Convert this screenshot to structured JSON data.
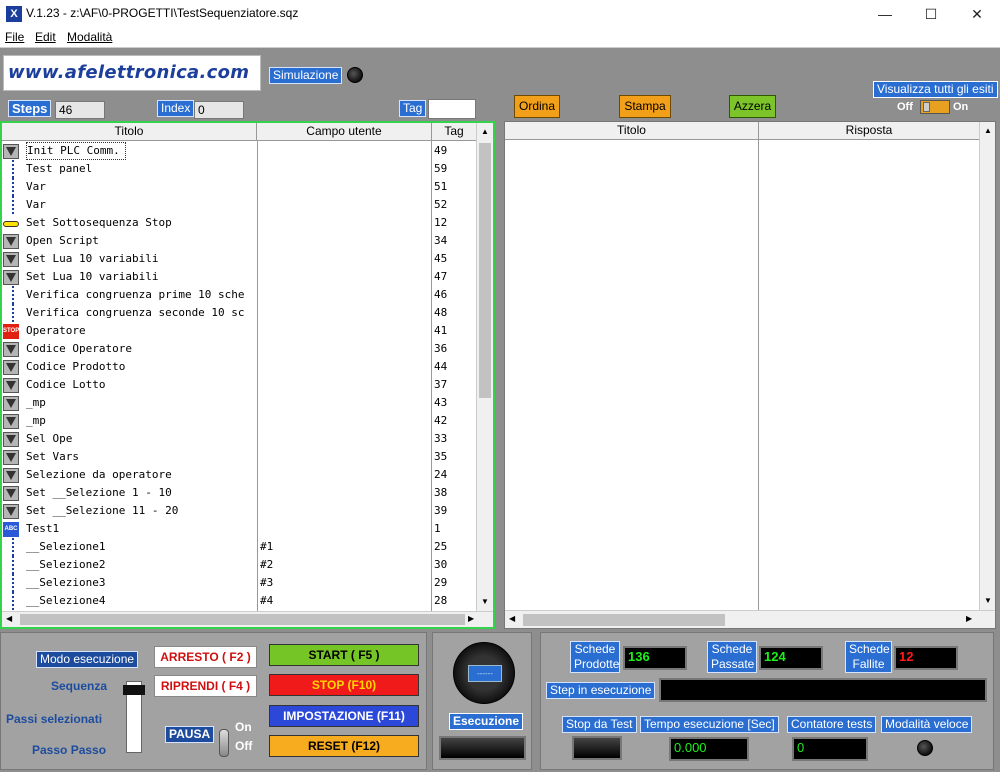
{
  "window": {
    "title": "V.1.23 - z:\\AF\\0-PROGETTI\\TestSequenziatore.sqz",
    "minimize": "—",
    "maximize": "☐",
    "close": "✕"
  },
  "menu": [
    "File",
    "Edit",
    "Modalità"
  ],
  "logo": "www.afelettronica.com",
  "simulazione": "Simulazione",
  "steps": {
    "label": "Steps",
    "value": "46"
  },
  "index": {
    "label": "Index",
    "value": "0"
  },
  "tag": {
    "label": "Tag",
    "value": ""
  },
  "toolbar": {
    "ordina": "Ordina",
    "stampa": "Stampa",
    "azzera": "Azzera"
  },
  "visualizza": {
    "label": "Visualizza tutti gli esiti",
    "off": "Off",
    "on": "On"
  },
  "left_table": {
    "headers": [
      "Titolo",
      "Campo utente",
      "Tag"
    ],
    "rows": [
      {
        "icon": "filter",
        "title": "Init PLC Comm.",
        "campo": "",
        "tag": "49"
      },
      {
        "icon": "line",
        "title": "Test panel",
        "campo": "",
        "tag": "59"
      },
      {
        "icon": "line",
        "title": "Var",
        "campo": "",
        "tag": "51"
      },
      {
        "icon": "line",
        "title": "Var",
        "campo": "",
        "tag": "52"
      },
      {
        "icon": "arrow",
        "title": "Set Sottosequenza Stop",
        "campo": "",
        "tag": "12"
      },
      {
        "icon": "filter",
        "title": "Open Script",
        "campo": "",
        "tag": "34"
      },
      {
        "icon": "filter",
        "title": "Set Lua 10 variabili",
        "campo": "",
        "tag": "45"
      },
      {
        "icon": "filter",
        "title": "Set Lua 10 variabili",
        "campo": "",
        "tag": "47"
      },
      {
        "icon": "line",
        "title": "Verifica congruenza prime 10 sche",
        "campo": "",
        "tag": "46"
      },
      {
        "icon": "line",
        "title": "Verifica congruenza seconde 10 sc",
        "campo": "",
        "tag": "48"
      },
      {
        "icon": "stop",
        "title": "Operatore",
        "campo": "",
        "tag": "41"
      },
      {
        "icon": "filter",
        "title": "Codice Operatore",
        "campo": "",
        "tag": "36"
      },
      {
        "icon": "filter",
        "title": "Codice Prodotto",
        "campo": "",
        "tag": "44"
      },
      {
        "icon": "filter",
        "title": "Codice Lotto",
        "campo": "",
        "tag": "37"
      },
      {
        "icon": "filter",
        "title": "_mp",
        "campo": "",
        "tag": "43"
      },
      {
        "icon": "filter",
        "title": "_mp",
        "campo": "",
        "tag": "42"
      },
      {
        "icon": "filter",
        "title": "Sel Ope",
        "campo": "",
        "tag": "33"
      },
      {
        "icon": "filter",
        "title": "Set Vars",
        "campo": "",
        "tag": "35"
      },
      {
        "icon": "filter",
        "title": "Selezione da operatore",
        "campo": "",
        "tag": "24"
      },
      {
        "icon": "filter",
        "title": "Set __Selezione 1 - 10",
        "campo": "",
        "tag": "38"
      },
      {
        "icon": "filter",
        "title": "Set __Selezione 11 - 20",
        "campo": "",
        "tag": "39"
      },
      {
        "icon": "abc",
        "title": "Test1",
        "campo": "",
        "tag": "1"
      },
      {
        "icon": "line",
        "title": "__Selezione1",
        "campo": "#1",
        "tag": "25"
      },
      {
        "icon": "line",
        "title": "__Selezione2",
        "campo": "#2",
        "tag": "30"
      },
      {
        "icon": "line",
        "title": "__Selezione3",
        "campo": "#3",
        "tag": "29"
      },
      {
        "icon": "line",
        "title": "__Selezione4",
        "campo": "#4",
        "tag": "28"
      }
    ]
  },
  "right_table": {
    "headers": [
      "Titolo",
      "Risposta"
    ]
  },
  "controls": {
    "modo": "Modo esecuzione",
    "sequenza": "Sequenza",
    "passi": "Passi selezionati",
    "passo": "Passo Passo",
    "pausa": "PAUSA",
    "on": "On",
    "off": "Off",
    "arresto": "ARRESTO ( F2 )",
    "riprendi": "RIPRENDI ( F4 )",
    "start": "START   ( F5 )",
    "stop": "STOP (F10)",
    "impostazione": "IMPOSTAZIONE (F11)",
    "reset": "RESET (F12)",
    "esecuzione": "Esecuzione",
    "indicator": "------"
  },
  "stats": {
    "prodotte_label": "Schede Prodotte",
    "prodotte": "136",
    "passate_label": "Schede Passate",
    "passate": "124",
    "fallite_label": "Schede Fallite",
    "fallite": "12",
    "step_label": "Step in esecuzione",
    "step": "",
    "stop_label": "Stop da Test",
    "tempo_label": "Tempo esecuzione [Sec]",
    "tempo": "0.000",
    "contatore_label": "Contatore tests",
    "contatore": "0",
    "veloce_label": "Modalità veloce"
  },
  "colors": {
    "accent": "#2a6ed2",
    "green_border": "#34d34b",
    "fallite": "#ff1a1a"
  }
}
